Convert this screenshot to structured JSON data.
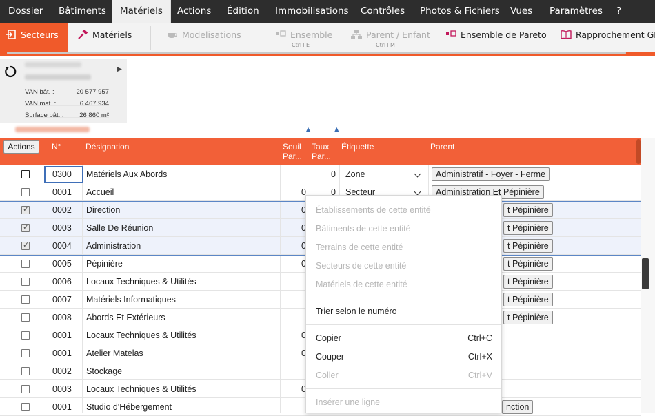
{
  "menu": [
    {
      "label": "Dossier"
    },
    {
      "label": "Bâtiments"
    },
    {
      "label": "Matériels"
    },
    {
      "label": "Actions"
    },
    {
      "label": "Édition"
    },
    {
      "label": "Immobilisations"
    },
    {
      "label": "Contrôles"
    },
    {
      "label": "Photos & Fichiers"
    },
    {
      "label": "Vues"
    },
    {
      "label": "Paramètres"
    },
    {
      "label": "?"
    }
  ],
  "toolbar": {
    "secteurs": "Secteurs",
    "materiels": "Matériels",
    "modelisations": "Modelisations",
    "ensemble": "Ensemble",
    "ensemble_shortcut": "Ctrl+E",
    "parent_enfant": "Parent / Enfant",
    "parent_enfant_shortcut": "Ctrl+M",
    "pareto": "Ensemble de Pareto",
    "rapprochement": "Rapprochement GM",
    "accent_color": "#f05a2a"
  },
  "info": {
    "van_bat_label": "VAN bât. :",
    "van_bat_value": "20 577 957",
    "van_mat_label": "VAN mat. :",
    "van_mat_value": "6 467 934",
    "surface_label": "Surface bât. :",
    "surface_value": "26 860 m²"
  },
  "table": {
    "actions_label": "Actions",
    "headers": {
      "num": "N°",
      "designation": "Désignation",
      "seuil_1": "Seuil",
      "seuil_2": "Par...",
      "taux_1": "Taux",
      "taux_2": "Par...",
      "etiquette": "Étiquette",
      "parent": "Parent"
    },
    "rows": [
      {
        "num": "0300",
        "designation": "Matériels Aux Abords",
        "seuil": "",
        "taux": "0",
        "etiquette": "Zone",
        "parent": "Administratif - Foyer - Ferme"
      },
      {
        "num": "0001",
        "designation": "Accueil",
        "seuil": "0",
        "taux": "0",
        "etiquette": "Secteur",
        "parent": "Administration Et Pépinière"
      },
      {
        "num": "0002",
        "designation": "Direction",
        "seuil": "0",
        "taux": "",
        "etiquette": "",
        "parent": "t Pépinière"
      },
      {
        "num": "0003",
        "designation": "Salle De Réunion",
        "seuil": "0",
        "taux": "",
        "etiquette": "",
        "parent": "t Pépinière"
      },
      {
        "num": "0004",
        "designation": "Administration",
        "seuil": "0",
        "taux": "",
        "etiquette": "",
        "parent": "t Pépinière"
      },
      {
        "num": "0005",
        "designation": "Pépinière",
        "seuil": "0",
        "taux": "",
        "etiquette": "",
        "parent": "t Pépinière"
      },
      {
        "num": "0006",
        "designation": "Locaux Techniques & Utilités",
        "seuil": "",
        "taux": "",
        "etiquette": "",
        "parent": "t Pépinière"
      },
      {
        "num": "0007",
        "designation": "Matériels Informatiques",
        "seuil": "",
        "taux": "",
        "etiquette": "",
        "parent": "t Pépinière"
      },
      {
        "num": "0008",
        "designation": "Abords Et Extérieurs",
        "seuil": "",
        "taux": "",
        "etiquette": "",
        "parent": "t Pépinière"
      },
      {
        "num": "0001",
        "designation": "Locaux Techniques & Utilités",
        "seuil": "0",
        "taux": "",
        "etiquette": "",
        "parent": ""
      },
      {
        "num": "0001",
        "designation": "Atelier Matelas",
        "seuil": "0",
        "taux": "",
        "etiquette": "",
        "parent": ""
      },
      {
        "num": "0002",
        "designation": "Stockage",
        "seuil": "",
        "taux": "",
        "etiquette": "",
        "parent": ""
      },
      {
        "num": "0003",
        "designation": "Locaux Techniques & Utilités",
        "seuil": "0",
        "taux": "",
        "etiquette": "",
        "parent": ""
      },
      {
        "num": "0001",
        "designation": "Studio d'Hébergement",
        "seuil": "",
        "taux": "",
        "etiquette": "",
        "parent": "nction"
      }
    ]
  },
  "context_menu": {
    "items": [
      {
        "label": "Établissements de cette entité",
        "disabled": true
      },
      {
        "label": "Bâtiments de cette entité",
        "disabled": true
      },
      {
        "label": "Terrains de cette entité",
        "disabled": true
      },
      {
        "label": "Secteurs de cette entité",
        "disabled": true
      },
      {
        "label": "Matériels de cette entité",
        "disabled": true
      },
      {
        "label": "Trier selon le numéro",
        "disabled": false
      },
      {
        "label": "Copier",
        "shortcut": "Ctrl+C",
        "disabled": false
      },
      {
        "label": "Couper",
        "shortcut": "Ctrl+X",
        "disabled": false
      },
      {
        "label": "Coller",
        "shortcut": "Ctrl+V",
        "disabled": true
      },
      {
        "label": "Insérer une ligne",
        "disabled": true
      }
    ]
  }
}
